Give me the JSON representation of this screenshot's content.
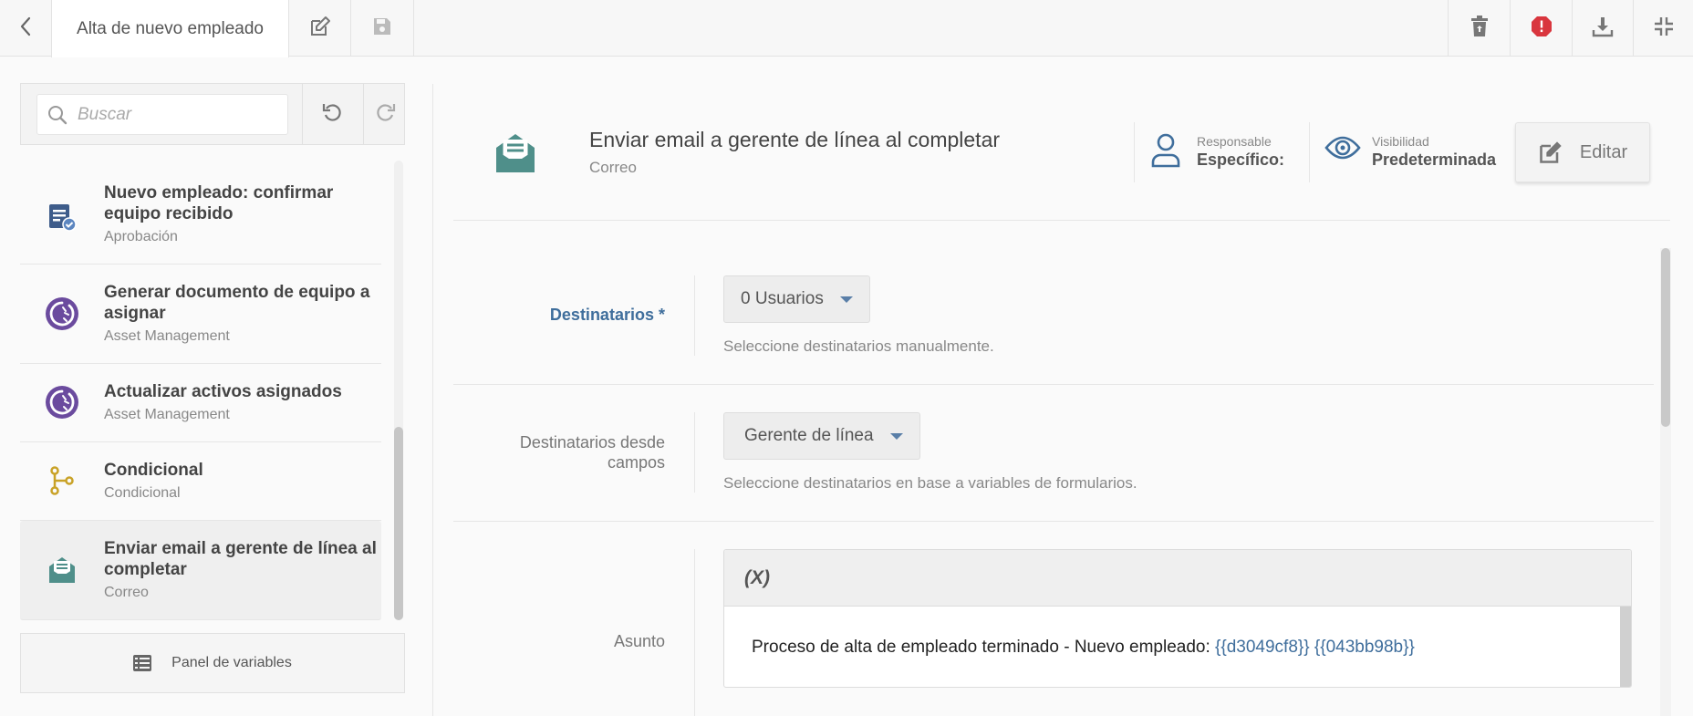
{
  "topbar": {
    "tab_title": "Alta de nuevo empleado",
    "icons": [
      "chevron-left-icon",
      "edit-icon",
      "save-icon",
      "trash-restore-icon",
      "alert-icon",
      "download-icon",
      "minimize-icon"
    ],
    "alert_color": "#d9363e"
  },
  "search": {
    "placeholder": "Buscar"
  },
  "tasks": [
    {
      "title": "Nuevo empleado: confirmar equipo recibido",
      "subtitle": "Aprobación",
      "icon": "approval-icon"
    },
    {
      "title": "Generar documento de equipo a asignar",
      "subtitle": "Asset Management",
      "icon": "asset-management-icon"
    },
    {
      "title": "Actualizar activos asignados",
      "subtitle": "Asset Management",
      "icon": "asset-management-icon"
    },
    {
      "title": "Condicional",
      "subtitle": "Condicional",
      "icon": "branch-icon"
    },
    {
      "title": "Enviar email a gerente de línea al completar",
      "subtitle": "Correo",
      "icon": "email-icon",
      "selected": true
    }
  ],
  "variables_panel": {
    "label": "Panel de variables"
  },
  "header": {
    "title": "Enviar email a gerente de línea al completar",
    "subtitle": "Correo",
    "responsable_label": "Responsable",
    "responsable_value": "Específico:",
    "visibilidad_label": "Visibilidad",
    "visibilidad_value": "Predeterminada",
    "edit_label": "Editar"
  },
  "form": {
    "destinatarios": {
      "label": "Destinatarios",
      "required_mark": "*",
      "dropdown_value": "0 Usuarios",
      "hint": "Seleccione destinatarios manualmente."
    },
    "destinatarios_campos": {
      "label_line1": "Destinatarios desde",
      "label_line2": "campos",
      "dropdown_value": "Gerente de línea",
      "hint": "Seleccione destinatarios en base a variables de formularios."
    },
    "asunto": {
      "label": "Asunto",
      "toolbar_label": "(X)",
      "text_prefix": "Proceso de alta de empleado terminado - Nuevo empleado: ",
      "var1": "{{d3049cf8}}",
      "var2": "{{043bb98b}}"
    }
  },
  "colors": {
    "accent_blue": "#3f6e9c",
    "email_teal": "#4f8f8a",
    "asset_purple": "#6b4b9e",
    "branch_gold": "#c9a227",
    "approval_navy": "#3e5c8a"
  }
}
